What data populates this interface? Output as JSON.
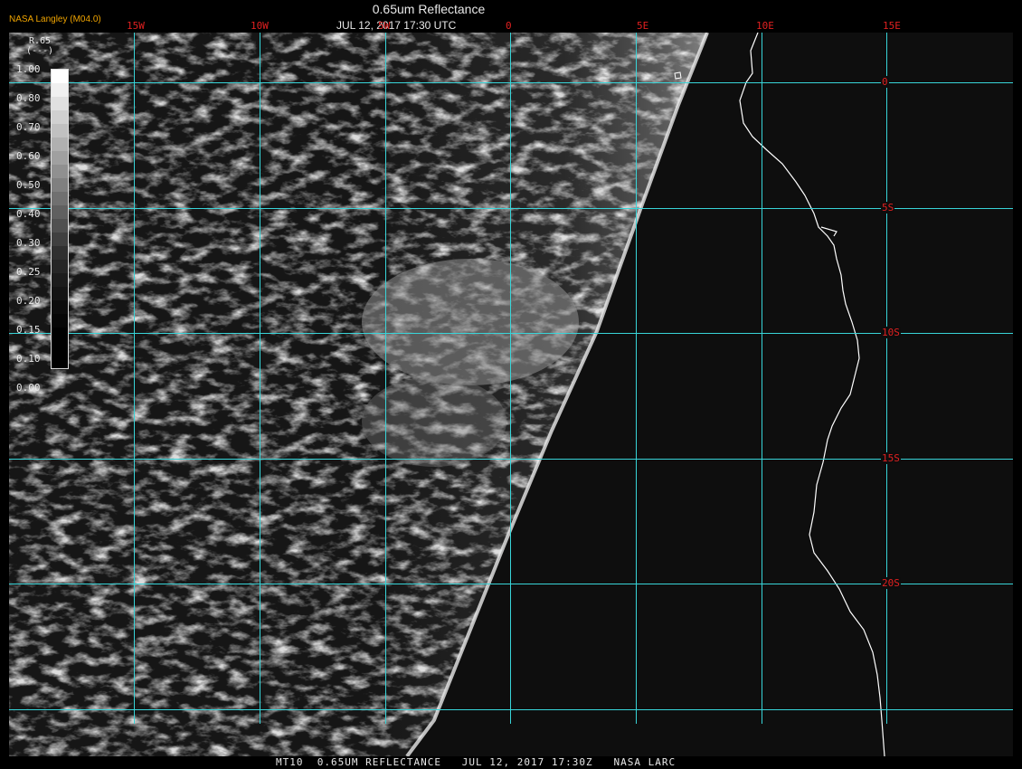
{
  "header": {
    "credit": "NASA Langley (M04.0)",
    "title": "0.65um Reflectance",
    "datetime": "JUL 12, 2017 17:30 UTC"
  },
  "longitude_labels": [
    "15W",
    "10W",
    "5W",
    "0",
    "5E",
    "10E",
    "15E"
  ],
  "latitude_labels": [
    "0",
    "5S",
    "10S",
    "15S",
    "20S"
  ],
  "legend": {
    "title": "R.65",
    "units": "(---)",
    "values": [
      "1.00",
      "0.80",
      "0.70",
      "0.60",
      "0.50",
      "0.40",
      "0.30",
      "0.25",
      "0.20",
      "0.15",
      "0.10",
      "0.00"
    ]
  },
  "footer": {
    "text": "MT10  0.65UM REFLECTANCE   JUL 12, 2017 17:30Z   NASA LARC"
  },
  "colors": {
    "grid": "#38d4d8",
    "labels": "#e02020",
    "credit": "#f0a400",
    "coastline": "#ffffff"
  }
}
